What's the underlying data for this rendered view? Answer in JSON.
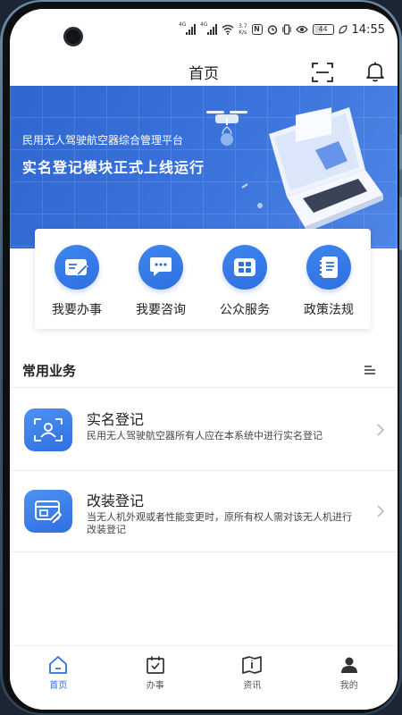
{
  "status_bar": {
    "network_tag_1": "4G",
    "network_tag_2": "4G",
    "speed_value": "3.7",
    "speed_unit": "K/s",
    "battery_level": "44",
    "time": "14:55"
  },
  "header": {
    "title": "首页"
  },
  "banner": {
    "subtitle": "民用无人驾驶航空器综合管理平台",
    "headline": "实名登记模块正式上线运行"
  },
  "quick_actions": [
    {
      "label": "我要办事",
      "icon": "edit-document-icon"
    },
    {
      "label": "我要咨询",
      "icon": "chat-bubble-icon"
    },
    {
      "label": "公众服务",
      "icon": "grid-apps-icon"
    },
    {
      "label": "政策法规",
      "icon": "notebook-icon"
    }
  ],
  "common_business": {
    "title": "常用业务",
    "items": [
      {
        "title": "实名登记",
        "description": "民用无人驾驶航空器所有人应在本系统中进行实名登记",
        "icon": "id-profile-icon"
      },
      {
        "title": "改装登记",
        "description": "当无人机外观或者性能变更时，原所有权人需对该无人机进行改装登记",
        "icon": "modify-edit-icon"
      }
    ]
  },
  "tab_bar": {
    "tabs": [
      {
        "label": "首页",
        "icon": "home-icon",
        "active": true
      },
      {
        "label": "办事",
        "icon": "calendar-check-icon",
        "active": false
      },
      {
        "label": "资讯",
        "icon": "open-book-icon",
        "active": false
      },
      {
        "label": "我的",
        "icon": "person-icon",
        "active": false
      }
    ]
  },
  "colors": {
    "accent": "#2f6fe0",
    "banner": "#3b74dc",
    "text": "#222222"
  }
}
